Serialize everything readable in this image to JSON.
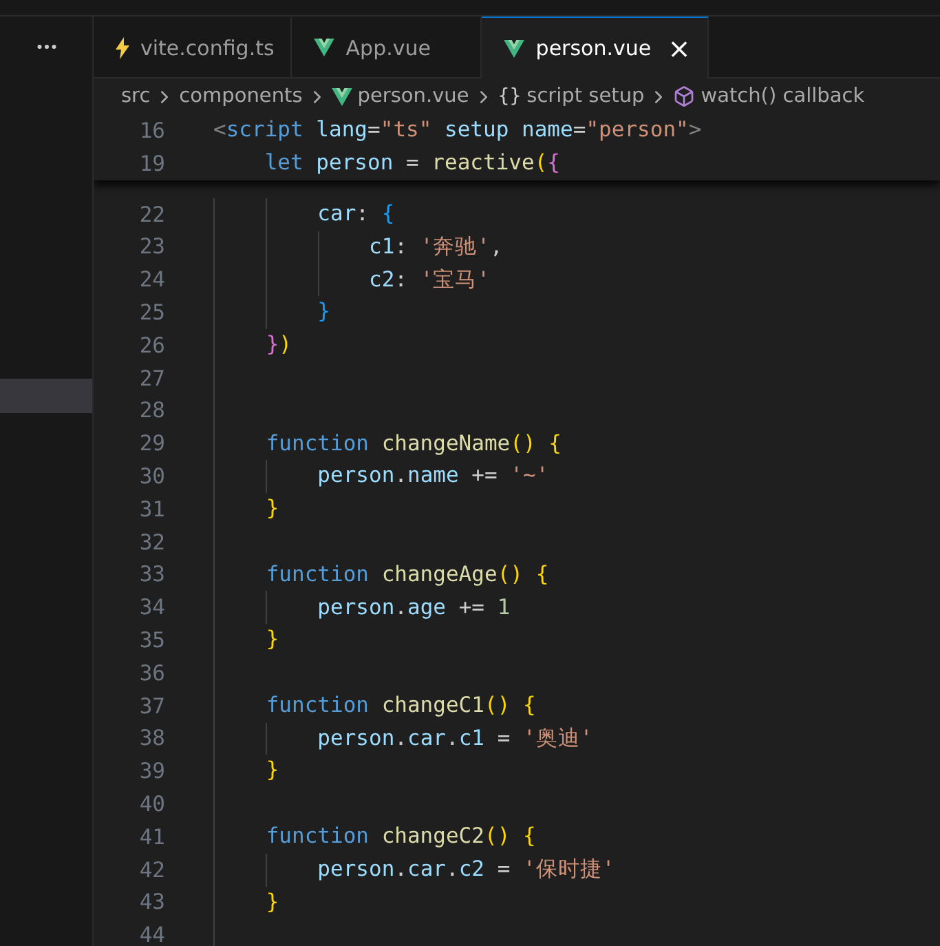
{
  "tabs": [
    {
      "label": "vite.config.ts",
      "kind": "config",
      "selected": false
    },
    {
      "label": "App.vue",
      "kind": "component",
      "selected": false
    },
    {
      "label": "person.vue",
      "kind": "component",
      "selected": true,
      "close": "×"
    }
  ],
  "breadcrumb": [
    {
      "label": "src",
      "kind": "folder"
    },
    {
      "label": "components",
      "kind": "folder"
    },
    {
      "label": "person.vue",
      "kind": "component"
    },
    {
      "label": "script setup",
      "kind": "namespace",
      "symbol": "{}"
    },
    {
      "label": "watch() callback",
      "kind": "method"
    }
  ],
  "sticky_lines": [
    {
      "number": "16",
      "tokens": [
        {
          "kind": "punct",
          "text": "<"
        },
        {
          "kind": "tag",
          "text": "script"
        },
        {
          "kind": "attr",
          "text": " lang"
        },
        {
          "kind": "plain",
          "text": "="
        },
        {
          "kind": "str",
          "text": "\"ts\""
        },
        {
          "kind": "attr",
          "text": " setup"
        },
        {
          "kind": "attr",
          "text": " name"
        },
        {
          "kind": "plain",
          "text": "="
        },
        {
          "kind": "str",
          "text": "\"person\""
        },
        {
          "kind": "punct",
          "text": ">"
        }
      ]
    },
    {
      "number": "19",
      "tokens": [
        {
          "kind": "kw",
          "text": "    let"
        },
        {
          "kind": "var",
          "text": " person"
        },
        {
          "kind": "plain",
          "text": " = "
        },
        {
          "kind": "fn",
          "text": "reactive"
        },
        {
          "kind": "b1",
          "text": "("
        },
        {
          "kind": "b2",
          "text": "{"
        }
      ]
    }
  ],
  "lines": [
    {
      "number": "22",
      "tokens": [
        {
          "kind": "var",
          "text": "        car"
        },
        {
          "kind": "plain",
          "text": ": "
        },
        {
          "kind": "b3",
          "text": "{"
        }
      ]
    },
    {
      "number": "23",
      "tokens": [
        {
          "kind": "var",
          "text": "            c1"
        },
        {
          "kind": "plain",
          "text": ": "
        },
        {
          "kind": "str",
          "text": "'奔驰'"
        },
        {
          "kind": "plain",
          "text": ","
        }
      ]
    },
    {
      "number": "24",
      "tokens": [
        {
          "kind": "var",
          "text": "            c2"
        },
        {
          "kind": "plain",
          "text": ": "
        },
        {
          "kind": "str",
          "text": "'宝马'"
        }
      ]
    },
    {
      "number": "25",
      "tokens": [
        {
          "kind": "b3",
          "text": "        }"
        }
      ]
    },
    {
      "number": "26",
      "tokens": [
        {
          "kind": "b2",
          "text": "    }"
        },
        {
          "kind": "b1",
          "text": ")"
        }
      ]
    },
    {
      "number": "27"
    },
    {
      "number": "28"
    },
    {
      "number": "29",
      "tokens": [
        {
          "kind": "kw",
          "text": "    function"
        },
        {
          "kind": "fn",
          "text": " changeName"
        },
        {
          "kind": "b1",
          "text": "()"
        },
        {
          "kind": "b1",
          "text": " {"
        }
      ]
    },
    {
      "number": "30",
      "tokens": [
        {
          "kind": "var",
          "text": "        person"
        },
        {
          "kind": "plain",
          "text": "."
        },
        {
          "kind": "var",
          "text": "name"
        },
        {
          "kind": "plain",
          "text": " += "
        },
        {
          "kind": "str",
          "text": "'~'"
        }
      ]
    },
    {
      "number": "31",
      "tokens": [
        {
          "kind": "b1",
          "text": "    }"
        }
      ]
    },
    {
      "number": "32"
    },
    {
      "number": "33",
      "tokens": [
        {
          "kind": "kw",
          "text": "    function"
        },
        {
          "kind": "fn",
          "text": " changeAge"
        },
        {
          "kind": "b1",
          "text": "()"
        },
        {
          "kind": "b1",
          "text": " {"
        }
      ]
    },
    {
      "number": "34",
      "tokens": [
        {
          "kind": "var",
          "text": "        person"
        },
        {
          "kind": "plain",
          "text": "."
        },
        {
          "kind": "var",
          "text": "age"
        },
        {
          "kind": "plain",
          "text": " += "
        },
        {
          "kind": "num",
          "text": "1"
        }
      ]
    },
    {
      "number": "35",
      "tokens": [
        {
          "kind": "b1",
          "text": "    }"
        }
      ]
    },
    {
      "number": "36"
    },
    {
      "number": "37",
      "tokens": [
        {
          "kind": "kw",
          "text": "    function"
        },
        {
          "kind": "fn",
          "text": " changeC1"
        },
        {
          "kind": "b1",
          "text": "()"
        },
        {
          "kind": "b1",
          "text": " {"
        }
      ]
    },
    {
      "number": "38",
      "tokens": [
        {
          "kind": "var",
          "text": "        person"
        },
        {
          "kind": "plain",
          "text": "."
        },
        {
          "kind": "var",
          "text": "car"
        },
        {
          "kind": "plain",
          "text": "."
        },
        {
          "kind": "var",
          "text": "c1"
        },
        {
          "kind": "plain",
          "text": " = "
        },
        {
          "kind": "str",
          "text": "'奥迪'"
        }
      ]
    },
    {
      "number": "39",
      "tokens": [
        {
          "kind": "b1",
          "text": "    }"
        }
      ]
    },
    {
      "number": "40"
    },
    {
      "number": "41",
      "tokens": [
        {
          "kind": "kw",
          "text": "    function"
        },
        {
          "kind": "fn",
          "text": " changeC2"
        },
        {
          "kind": "b1",
          "text": "()"
        },
        {
          "kind": "b1",
          "text": " {"
        }
      ]
    },
    {
      "number": "42",
      "tokens": [
        {
          "kind": "var",
          "text": "        person"
        },
        {
          "kind": "plain",
          "text": "."
        },
        {
          "kind": "var",
          "text": "car"
        },
        {
          "kind": "plain",
          "text": "."
        },
        {
          "kind": "var",
          "text": "c2"
        },
        {
          "kind": "plain",
          "text": " = "
        },
        {
          "kind": "str",
          "text": "'保时捷'"
        }
      ]
    },
    {
      "number": "43",
      "tokens": [
        {
          "kind": "b1",
          "text": "    }"
        }
      ]
    },
    {
      "number": "44"
    }
  ]
}
